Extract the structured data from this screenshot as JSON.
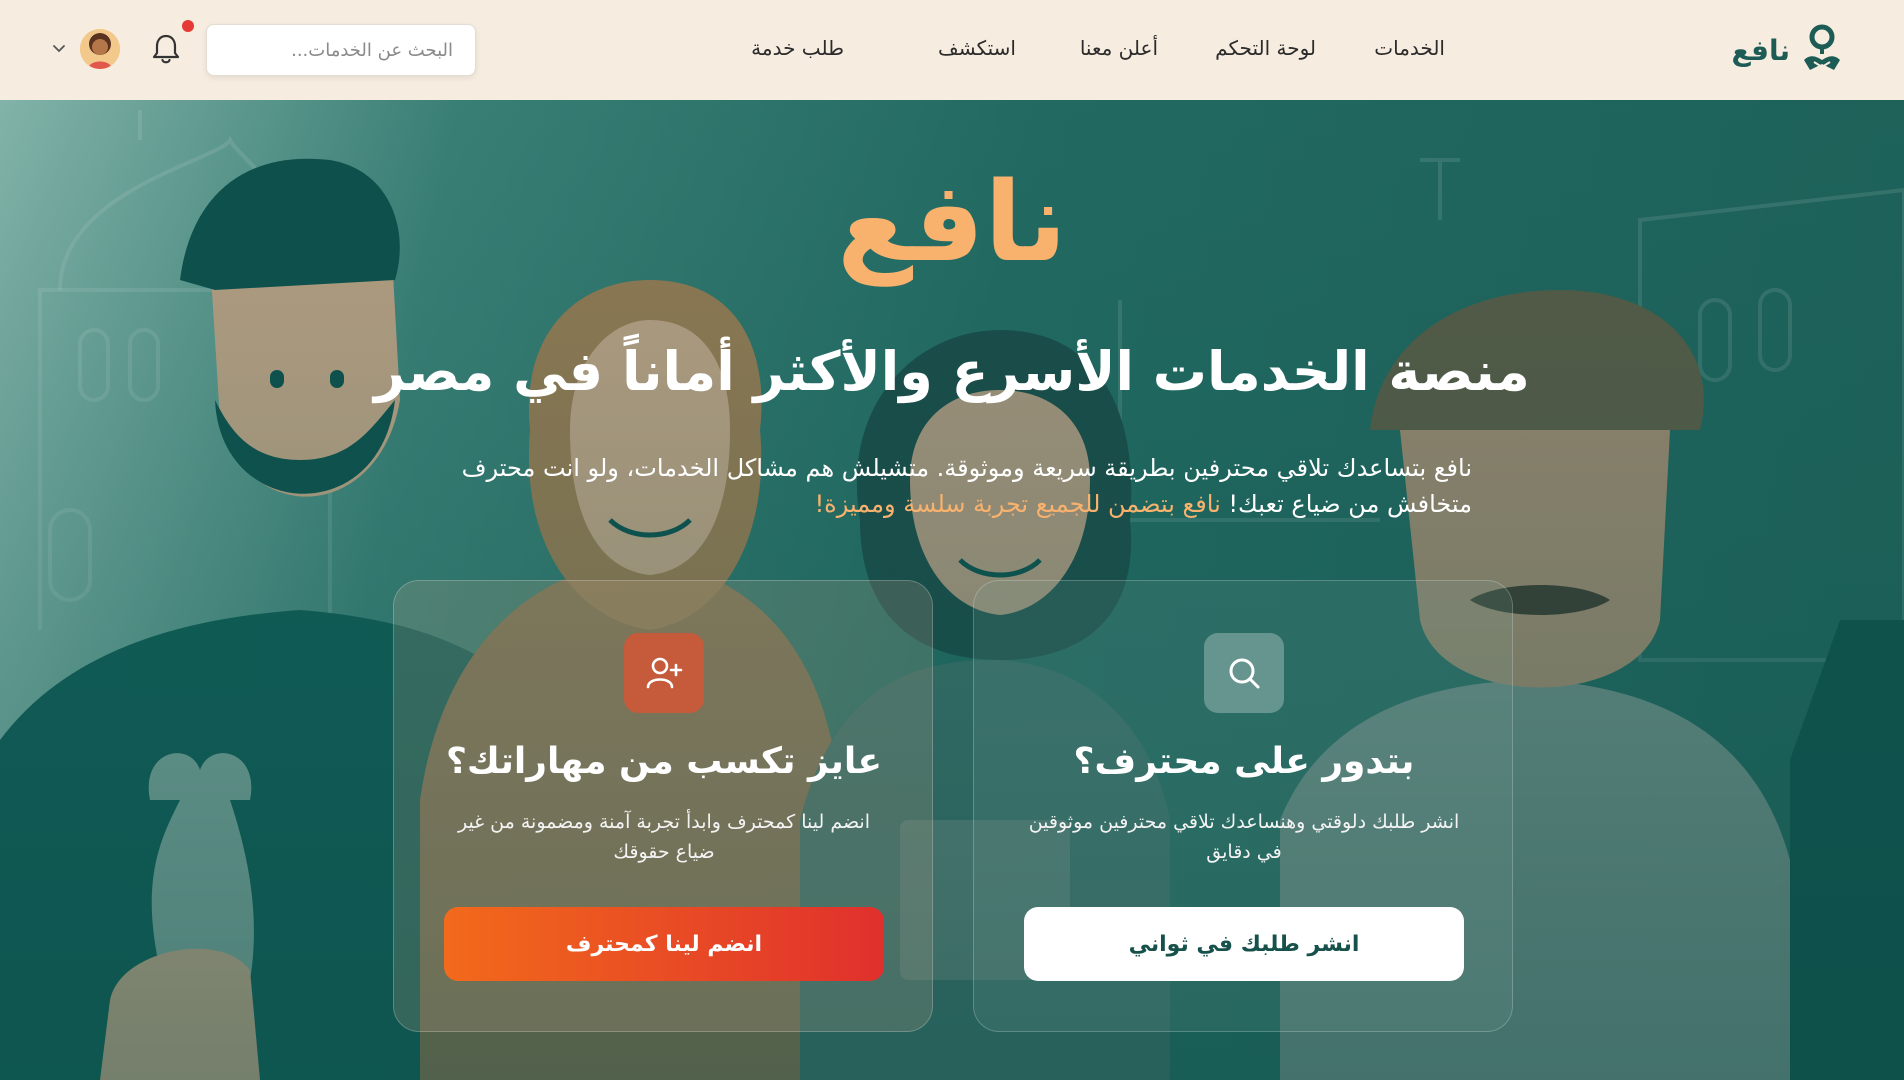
{
  "header": {
    "brand_name": "نافع",
    "nav": [
      {
        "label": "الخدمات"
      },
      {
        "label": "لوحة التحكم"
      },
      {
        "label": "أعلن معنا"
      },
      {
        "label": "استكشف"
      },
      {
        "label": "طلب خدمة"
      }
    ],
    "search": {
      "placeholder": "البحث عن الخدمات...",
      "icon": "search-icon"
    },
    "notifications": {
      "icon": "bell-icon",
      "has_unread": true,
      "dot_color": "#e53935"
    },
    "user_menu": {
      "icon": "chevron-down-icon"
    }
  },
  "hero": {
    "title": "نافع",
    "subtitle": "منصة الخدمات الأسرع والأكثر أماناً في مصر",
    "description": "نافع بتساعدك تلاقي محترفين بطريقة سريعة وموثوقة. متشيلش هم مشاكل الخدمات، ولو انت محترف متخافش من ضياع تعبك!",
    "description_highlight": "نافع بتضمن للجميع تجربة سلسة ومميزة!"
  },
  "cards": {
    "find": {
      "icon": "search-icon",
      "title": "بتدور على محترف؟",
      "text": "انشر طلبك دلوقتي وهنساعدك تلاقي محترفين موثوقين في دقايق",
      "button": "انشر طلبك في ثواني"
    },
    "join": {
      "icon": "user-plus-icon",
      "title": "عايز تكسب من مهاراتك؟",
      "text": "انضم لينا كمحترف وابدأ تجربة آمنة ومضمونة من غير ضياع حقوقك",
      "button": "انضم لينا كمحترف"
    }
  },
  "colors": {
    "accent_orange": "#f9b26e",
    "brand_green": "#1c5c55",
    "header_bg": "#f6ece0",
    "cta_gradient_start": "#f26a1b",
    "cta_gradient_end": "#e0302d"
  }
}
